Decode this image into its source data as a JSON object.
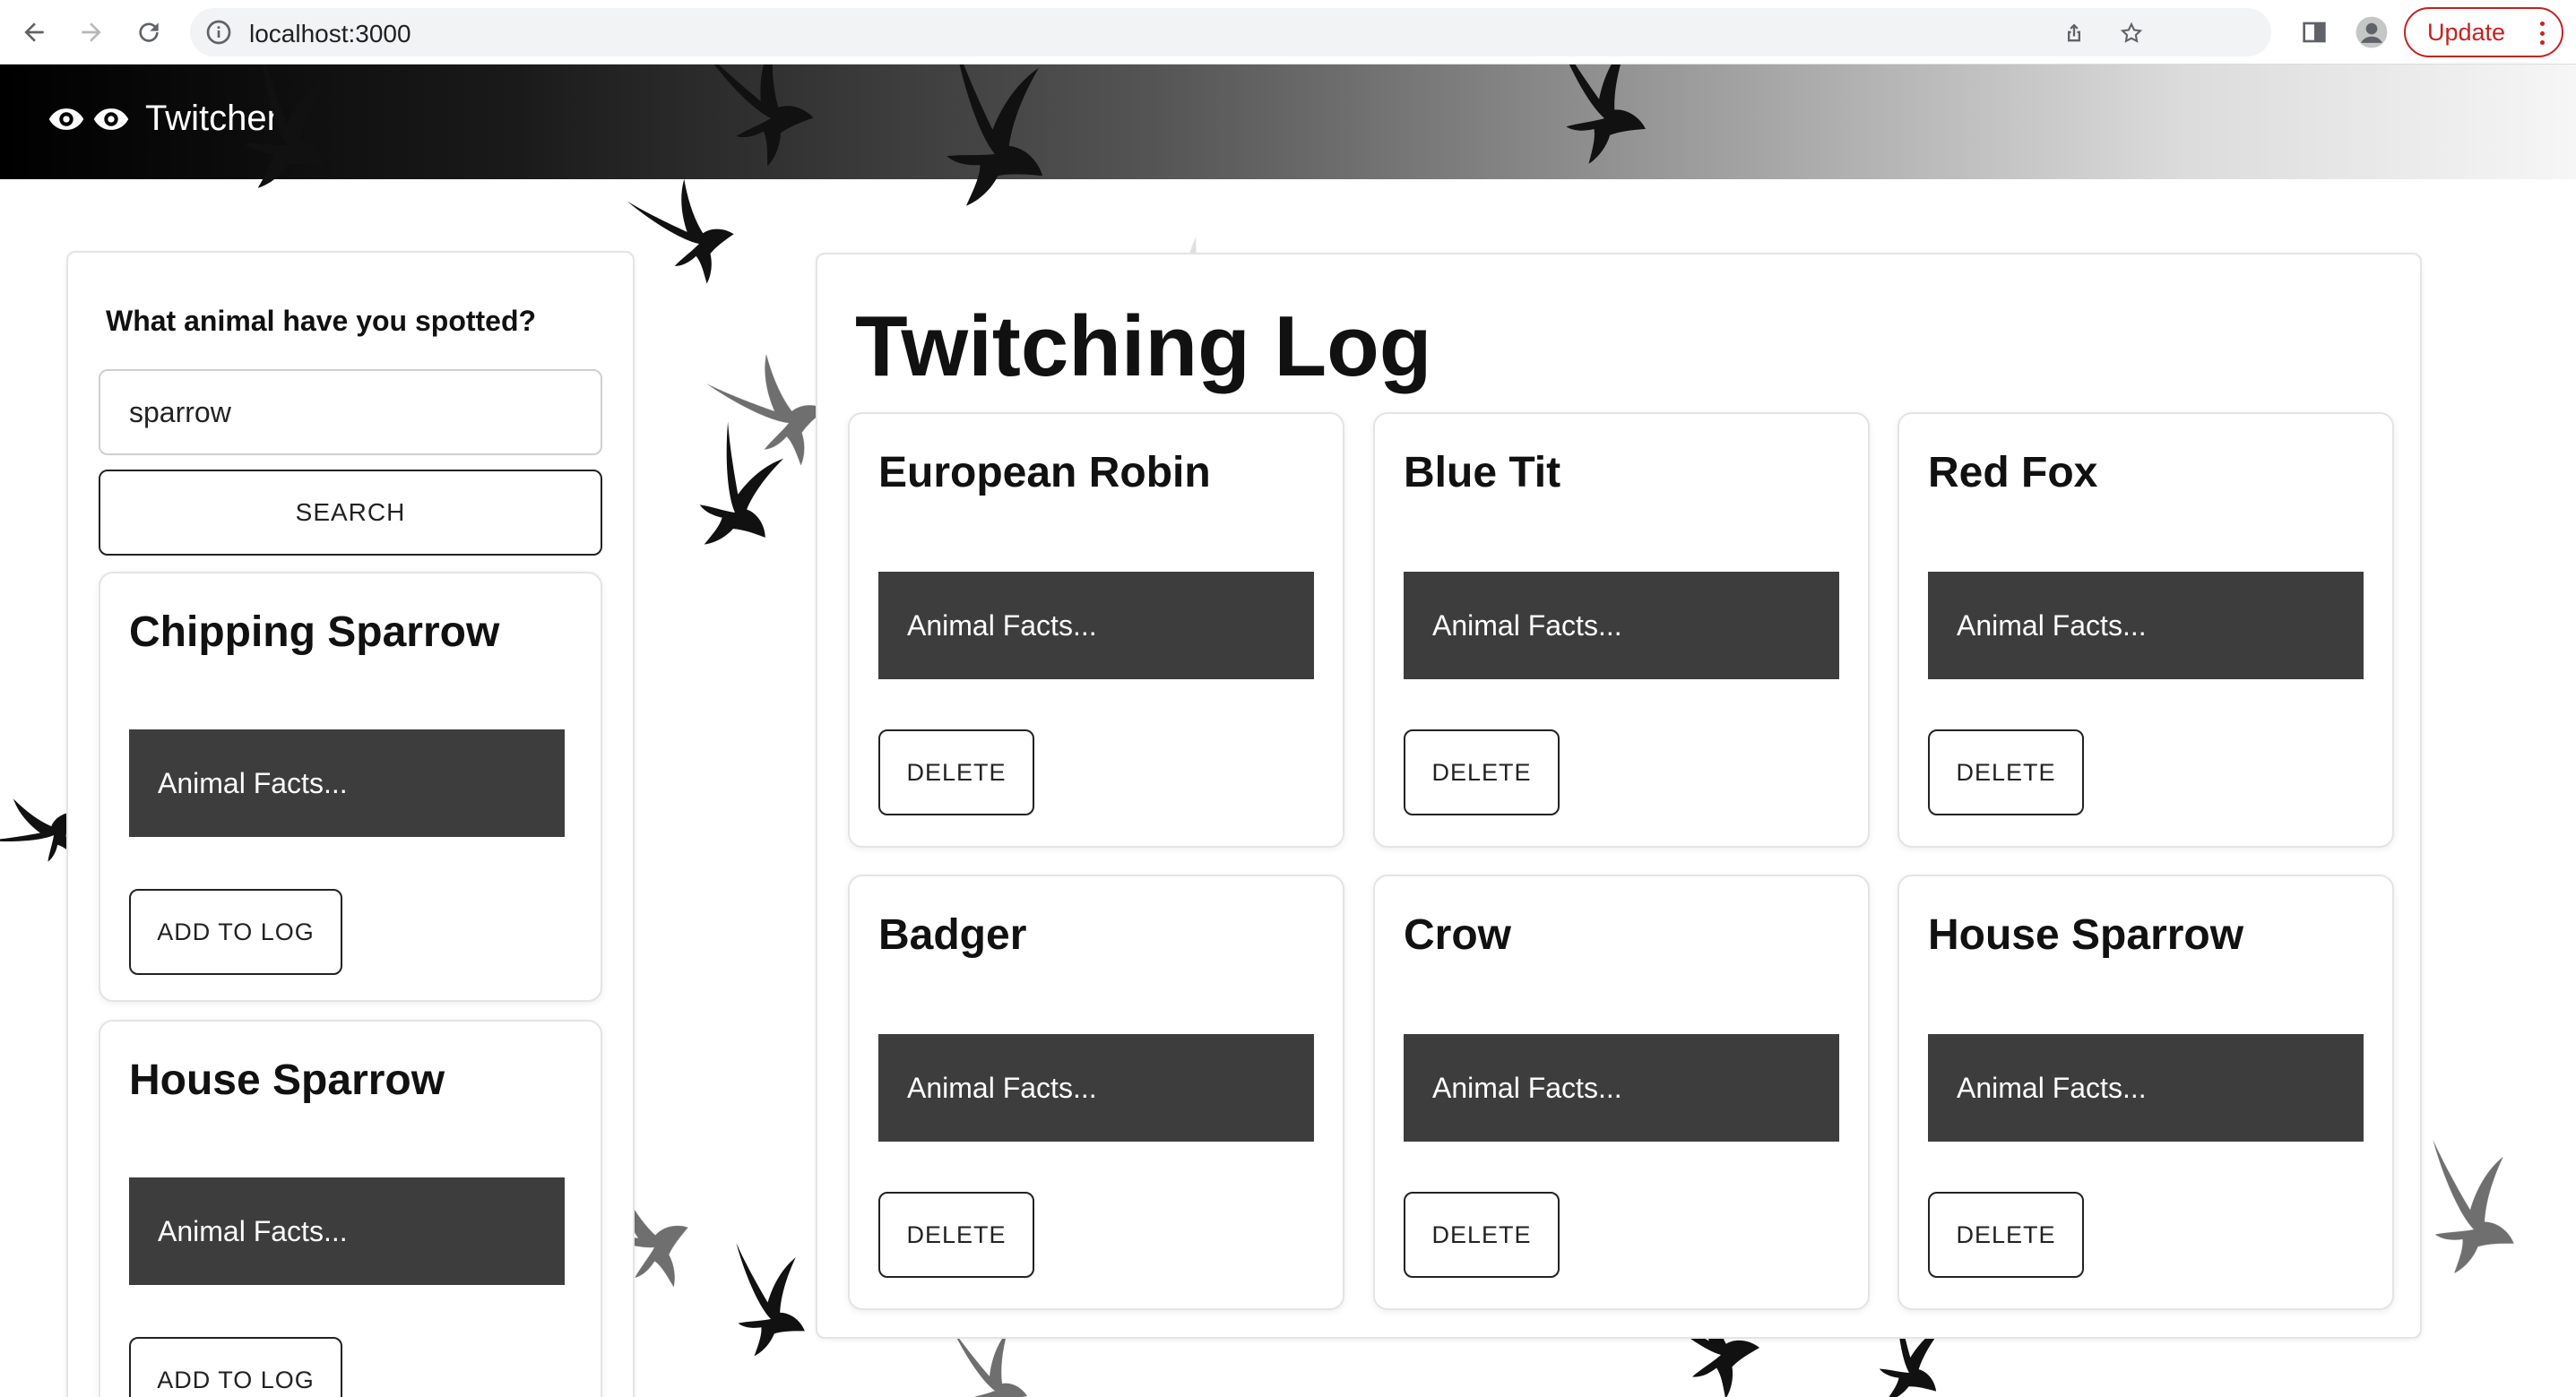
{
  "browser": {
    "url": "localhost:3000",
    "update_label": "Update",
    "icons": [
      "back-arrow-icon",
      "forward-arrow-icon",
      "reload-icon",
      "info-icon",
      "share-icon",
      "star-icon",
      "side-panel-icon",
      "profile-icon",
      "more-vert-icon"
    ]
  },
  "header": {
    "title": "Twitcher",
    "logo_icon": "eyes-icon"
  },
  "search": {
    "prompt": "What animal have you spotted?",
    "value": "sparrow",
    "button_label": "SEARCH",
    "results": [
      {
        "name": "Chipping Sparrow",
        "facts": "Animal Facts...",
        "action": "ADD TO LOG"
      },
      {
        "name": "House Sparrow",
        "facts": "Animal Facts...",
        "action": "ADD TO LOG"
      }
    ]
  },
  "log": {
    "title": "Twitching Log",
    "entries": [
      {
        "name": "European Robin",
        "facts": "Animal Facts...",
        "action": "DELETE"
      },
      {
        "name": "Blue Tit",
        "facts": "Animal Facts...",
        "action": "DELETE"
      },
      {
        "name": "Red Fox",
        "facts": "Animal Facts...",
        "action": "DELETE"
      },
      {
        "name": "Badger",
        "facts": "Animal Facts...",
        "action": "DELETE"
      },
      {
        "name": "Crow",
        "facts": "Animal Facts...",
        "action": "DELETE"
      },
      {
        "name": "House Sparrow",
        "facts": "Animal Facts...",
        "action": "DELETE"
      }
    ]
  },
  "colors": {
    "facts_bg": "#3d3d3d",
    "update_red": "#c5221f"
  }
}
